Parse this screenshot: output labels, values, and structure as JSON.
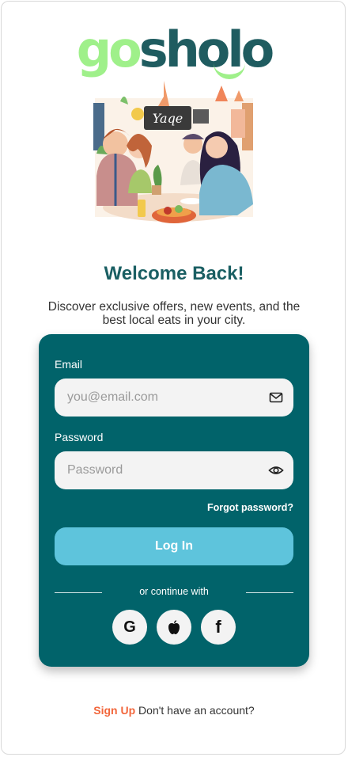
{
  "brand": {
    "logo_part1": "go",
    "logo_part2": "sholo"
  },
  "hero": {
    "sign_text": "Yaqe"
  },
  "welcome": {
    "title": "Welcome Back!",
    "subtitle": "Discover exclusive offers, new events, and the best local eats in your city."
  },
  "form": {
    "email_label": "Email",
    "email_placeholder": "you@email.com",
    "email_value": "",
    "password_label": "Password",
    "password_placeholder": "Password",
    "password_value": "",
    "forgot_label": "Forgot password?",
    "login_label": "Log In",
    "divider_text": "or continue with"
  },
  "social": [
    {
      "icon": "google-icon",
      "glyph": "G"
    },
    {
      "icon": "apple-icon"
    },
    {
      "icon": "facebook-icon",
      "glyph": "f"
    }
  ],
  "footer": {
    "signup_label": "Sign Up",
    "prompt": "Don't have an account?"
  },
  "colors": {
    "primary": "#01636a",
    "accent": "#5ec4dc",
    "logo_green": "#9ff08a",
    "signup": "#f2663b"
  }
}
